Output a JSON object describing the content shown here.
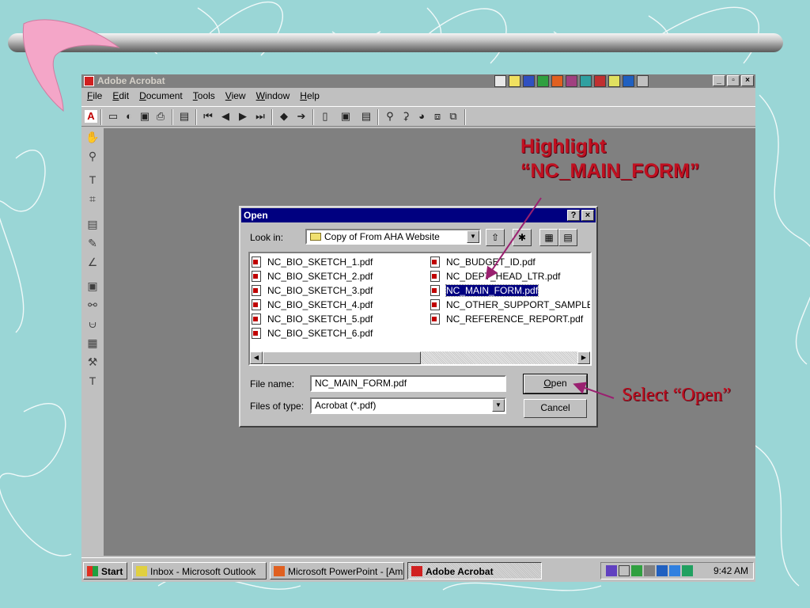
{
  "app": {
    "title": "Adobe Acrobat",
    "menu": [
      "File",
      "Edit",
      "Document",
      "Tools",
      "View",
      "Window",
      "Help"
    ]
  },
  "dialog": {
    "title": "Open",
    "help_label": "?",
    "close_label": "×",
    "look_in_label": "Look in:",
    "look_in_value": "Copy of From AHA Website",
    "files_left": [
      "NC_BIO_SKETCH_1.pdf",
      "NC_BIO_SKETCH_2.pdf",
      "NC_BIO_SKETCH_3.pdf",
      "NC_BIO_SKETCH_4.pdf",
      "NC_BIO_SKETCH_5.pdf",
      "NC_BIO_SKETCH_6.pdf"
    ],
    "files_right": [
      "NC_BUDGET_ID.pdf",
      "NC_DEPT_HEAD_LTR.pdf",
      "NC_MAIN_FORM.pdf",
      "NC_OTHER_SUPPORT_SAMPLE.pdf",
      "NC_REFERENCE_REPORT.pdf"
    ],
    "selected_file": "NC_MAIN_FORM.pdf",
    "file_name_label": "File name:",
    "file_name_value": "NC_MAIN_FORM.pdf",
    "files_of_type_label": "Files of type:",
    "files_of_type_value": "Acrobat (*.pdf)",
    "open_label": "Open",
    "cancel_label": "Cancel"
  },
  "taskbar": {
    "start_label": "Start",
    "items": [
      "Inbox - Microsoft Outlook",
      "Microsoft PowerPoint - [Am...",
      "Adobe Acrobat"
    ],
    "clock": "9:42 AM"
  },
  "annotations": {
    "highlight_line1": "Highlight",
    "highlight_line2": "“NC_MAIN_FORM”",
    "select_open": "Select “Open”"
  },
  "colors": {
    "background": "#9ad6d6",
    "annotation": "#c01020",
    "dialog_title": "#000080",
    "workspace": "#808080"
  }
}
